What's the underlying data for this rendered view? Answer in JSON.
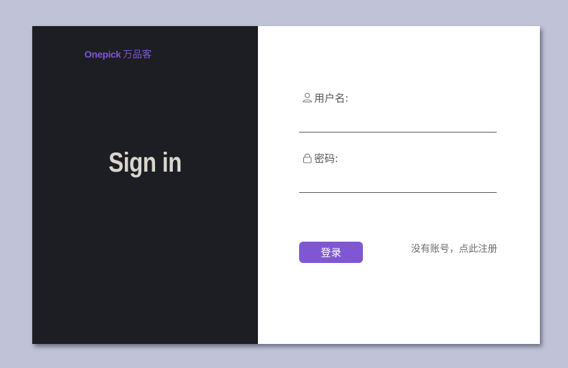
{
  "brand": {
    "name_en": "Onepick",
    "name_cn": "万品客"
  },
  "hero": {
    "title": "Sign in"
  },
  "form": {
    "username": {
      "label": "用户名:",
      "icon": "user-icon",
      "value": "",
      "placeholder": ""
    },
    "password": {
      "label": "密码:",
      "icon": "lock-icon",
      "value": "",
      "placeholder": ""
    },
    "login_label": "登录",
    "register_label": "没有账号，点此注册"
  },
  "colors": {
    "page_background": "#c0c3d8",
    "left_panel": "#1d1e23",
    "accent": "#7f57d4",
    "hero_text": "#d9d6cd",
    "right_panel": "#ffffff"
  }
}
